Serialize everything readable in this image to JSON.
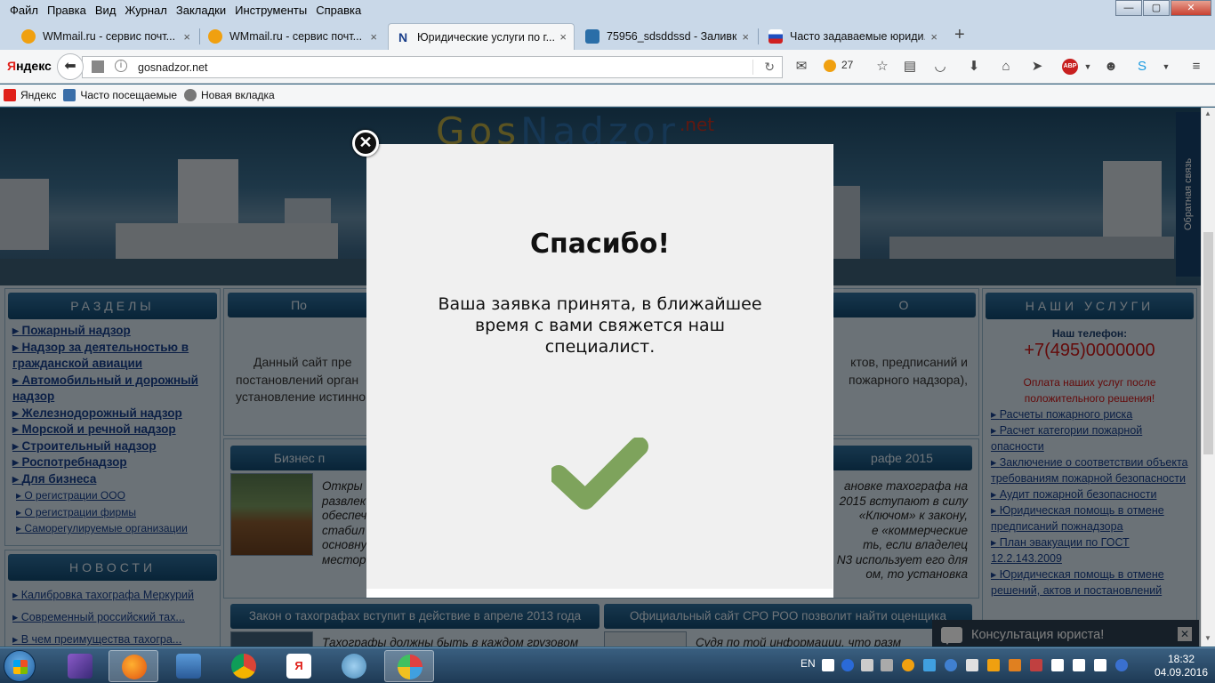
{
  "menu": [
    "Файл",
    "Правка",
    "Вид",
    "Журнал",
    "Закладки",
    "Инструменты",
    "Справка"
  ],
  "window_controls": {
    "minimize": "—",
    "maximize": "▢",
    "close": "✕"
  },
  "tabs": [
    {
      "title": "WMmail.ru - сервис почт...",
      "active": false,
      "favicon_color": "#f0a010"
    },
    {
      "title": "WMmail.ru - сервис почт...",
      "active": false,
      "favicon_color": "#f0a010"
    },
    {
      "title": "Юридические услуги по г...",
      "active": true,
      "favicon_color": "#1a3e8a",
      "favicon_letter": "N"
    },
    {
      "title": "75956_sdsddssd - Заливка ...",
      "active": false,
      "favicon_color": "#2a6ea8"
    },
    {
      "title": "Часто задаваемые юриди...",
      "active": false,
      "favicon_color": "#d02020"
    }
  ],
  "tab_close": "×",
  "new_tab": "+",
  "nav": {
    "yandex_logo_y": "Я",
    "yandex_logo_rest": "ндекс",
    "url": "gosnadzor.net",
    "weather_temp": "27",
    "info_icon": "i"
  },
  "bookmarks": [
    {
      "label": "Яндекс",
      "color": "#e0201a"
    },
    {
      "label": "Часто посещаемые",
      "color": "#3a6ea8"
    },
    {
      "label": "Новая вкладка",
      "color": "#777"
    }
  ],
  "site": {
    "logo_a": "Gos",
    "logo_b": "Nadzor",
    "logo_sup": ".net",
    "feedback": "Обратная связь",
    "sections_title": "РАЗДЕЛЫ",
    "sections": [
      "Пожарный надзор",
      "Надзор за деятельностью в гражданской авиации",
      "Автомобильный и дорожный надзор",
      "Железнодорожный надзор",
      "Морской и речной надзор",
      "Строительный надзор",
      "Роспотребнадзор",
      "Для бизнеса"
    ],
    "subsections": [
      "О регистрации ООО",
      "О регистрации фирмы",
      "Саморегулируемые организации"
    ],
    "news_title": "НОВОСТИ",
    "news": [
      "Калибровка тахографа Меркурий",
      "Современный российский тах...",
      "В чем преимущества тахогра..."
    ],
    "mid_hdr_1": "По",
    "mid_hdr_1b": "О",
    "mid_text_a": "Данный сайт пре",
    "mid_text_a2": "постановлений орган",
    "mid_text_a3": "установление истинно",
    "mid_text_b": "ктов, предписаний и",
    "mid_text_b2": "пожарного надзора),",
    "biz_hdr": "Бизнес п",
    "biz_hdr_b": "рафе 2015",
    "biz_left_lines": [
      "Откры",
      "развлек",
      "обеспеч",
      "стабил",
      "основну",
      "местор"
    ],
    "biz_right_lines": [
      "ановке тахографа на",
      "2015 вступают в силу",
      "«Ключом» к закону,",
      "е «коммерческие",
      "ть, если владелец",
      "N3 использует его для",
      "ом, то установка"
    ],
    "law_hdr": "Закон о тахографах вступит в действие в апреле 2013 года",
    "law_text": "Тахографы должны быть в каждом грузовом",
    "sro_hdr": "Официальный сайт СРО РОО позволит найти оценщика",
    "sro_text": "Судя по той информации, что разм",
    "services_title": "НАШИ УСЛУГИ",
    "phone_label": "Наш телефон:",
    "phone": "+7(495)0000000",
    "payment_note": "Оплата наших услуг после положительного решения!",
    "services": [
      "Расчеты пожарного риска",
      "Расчет категории пожарной опасности",
      "Заключение о соответствии объекта требованиям пожарной безопасности",
      "Аудит пожарной безопасности",
      "Юридическая помощь в отмене предписаний пожнадзора",
      "План эвакуации по ГОСТ 12.2.143.2009",
      "Юридическая помощь в отмене решений, актов и постановлений"
    ],
    "consult": "Консультация юриста!",
    "consult_close": "✕"
  },
  "modal": {
    "title": "Спасибо!",
    "message": "Ваша заявка принята, в ближайшее время с вами свяжется наш специалист.",
    "close": "✕",
    "check_color": "#7ea35c"
  },
  "taskbar": {
    "lang": "EN",
    "time": "18:32",
    "date": "04.09.2016"
  }
}
